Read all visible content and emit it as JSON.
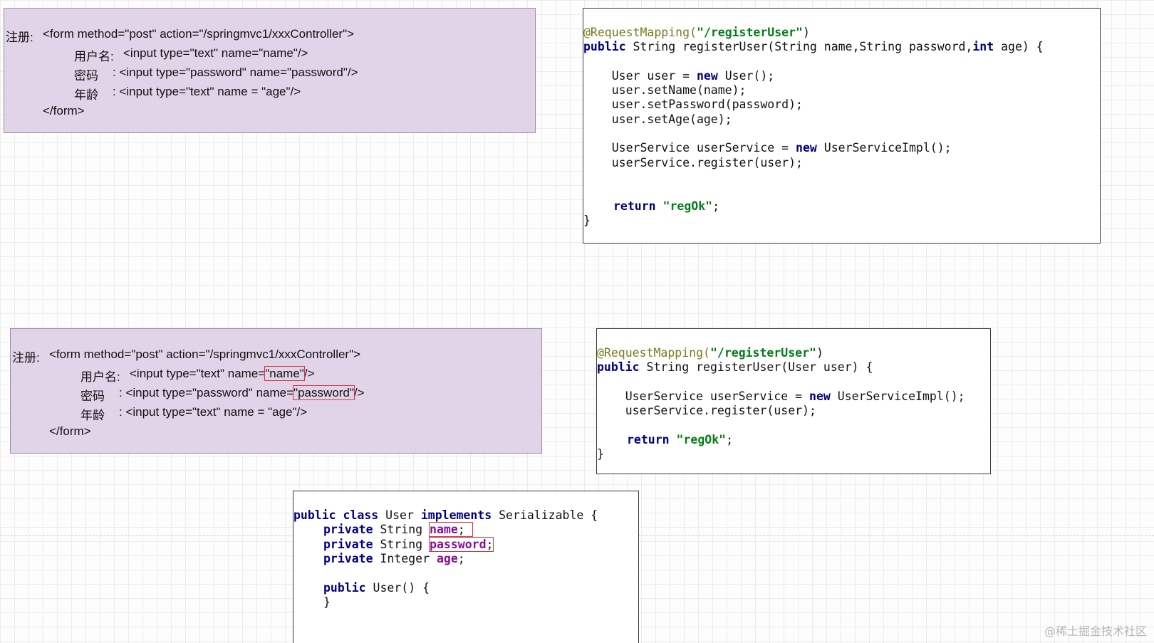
{
  "form1": {
    "label": "注册:",
    "open_tag": "<form method=\"post\" action=\"/springmvc1/xxxController\">",
    "rows": [
      {
        "label": "用户名:",
        "code": "<input type=\"text\" name=\"name\"/>"
      },
      {
        "label": "密码",
        "code": ": <input type=\"password\" name=\"password\"/>"
      },
      {
        "label": "年龄",
        "code": ": <input type=\"text\" name = \"age\"/>"
      }
    ],
    "close_tag": "</form>"
  },
  "form2": {
    "label": "注册:",
    "open_tag": "<form method=\"post\" action=\"/springmvc1/xxxController\">",
    "row1_label": "用户名:",
    "row1_pre": "<input type=\"text\" name=",
    "row1_hl": "\"name\"",
    "row1_post": "/>",
    "row2_label": "密码",
    "row2_pre": ": <input type=\"password\" name=",
    "row2_hl": "\"password\"",
    "row2_post": "/>",
    "row3_label": "年龄",
    "row3_code": ": <input type=\"text\" name = \"age\"/>",
    "close_tag": "</form>"
  },
  "code1": {
    "annotation": "@RequestMapping(",
    "mapping": "\"/registerUser\"",
    "annotation_end": ")",
    "kw_public": "public",
    "sig_a": " String registerUser(String name,String password,",
    "kw_int": "int",
    "sig_b": " age) {",
    "l_user_pre": "    User user = ",
    "kw_new": "new",
    "l_user_post": " User();",
    "l_setname": "    user.setName(name);",
    "l_setpassword": "    user.setPassword(password);",
    "l_setage": "    user.setAge(age);",
    "l_svc_pre": "    UserService userService = ",
    "l_svc_post": " UserServiceImpl();",
    "l_register": "    userService.register(user);",
    "kw_return": "return",
    "ret_str": "\"regOk\"",
    "semi": ";",
    "close": "}"
  },
  "code2": {
    "annotation": "@RequestMapping(",
    "mapping": "\"/registerUser\"",
    "annotation_end": ")",
    "kw_public": "public",
    "sig": " String registerUser(User user) {",
    "l_svc_pre": "    UserService userService = ",
    "kw_new": "new",
    "l_svc_post": " UserServiceImpl();",
    "l_register": "    userService.register(user);",
    "kw_return": "return",
    "ret_str": "\"regOk\"",
    "semi": ";",
    "close": "}"
  },
  "code3": {
    "kw_public": "public",
    "kw_class": "class",
    "cls_name": " User ",
    "kw_implements": "implements",
    "cls_rest": " Serializable {",
    "kw_private": "private",
    "type_string": " String ",
    "type_integer": " Integer ",
    "field_name": "name",
    "field_password": "password",
    "field_age": "age",
    "semi": ";",
    "ctor": " User() {",
    "ctor_close": "}"
  },
  "watermark": "@稀土掘金技术社区"
}
